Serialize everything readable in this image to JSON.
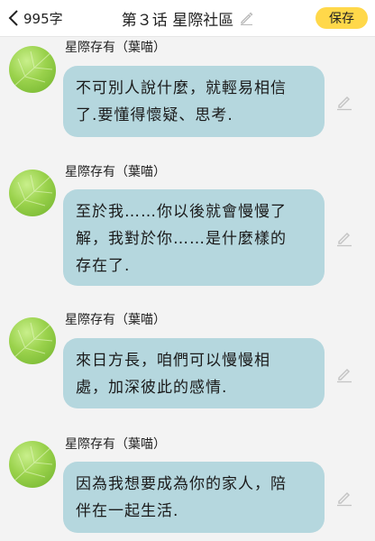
{
  "header": {
    "word_count": "995字",
    "title": "第３话 星際社區",
    "save_label": "保存"
  },
  "messages": [
    {
      "sender": "星際存有（葉喵）",
      "lines": [
        "不可別人說什麼，就輕易相信",
        "了.要懂得懷疑、思考."
      ]
    },
    {
      "sender": "星際存有（葉喵）",
      "lines": [
        "至於我……你以後就會慢慢了",
        "解，我對於你……是什麼樣的",
        "存在了."
      ]
    },
    {
      "sender": "星際存有（葉喵）",
      "lines": [
        "來日方長，咱們可以慢慢相",
        "處，加深彼此的感情."
      ]
    },
    {
      "sender": "星際存有（葉喵）",
      "lines": [
        "因為我想要成為你的家人，陪",
        "伴在一起生活."
      ]
    }
  ],
  "colors": {
    "bubble": "#b5d7de",
    "save_button": "#ffd84a",
    "background": "#f3f3f3",
    "avatar_green": "#9ad24c"
  },
  "icons": [
    "chevron-left-icon",
    "pencil-icon",
    "edit-icon",
    "avatar"
  ]
}
